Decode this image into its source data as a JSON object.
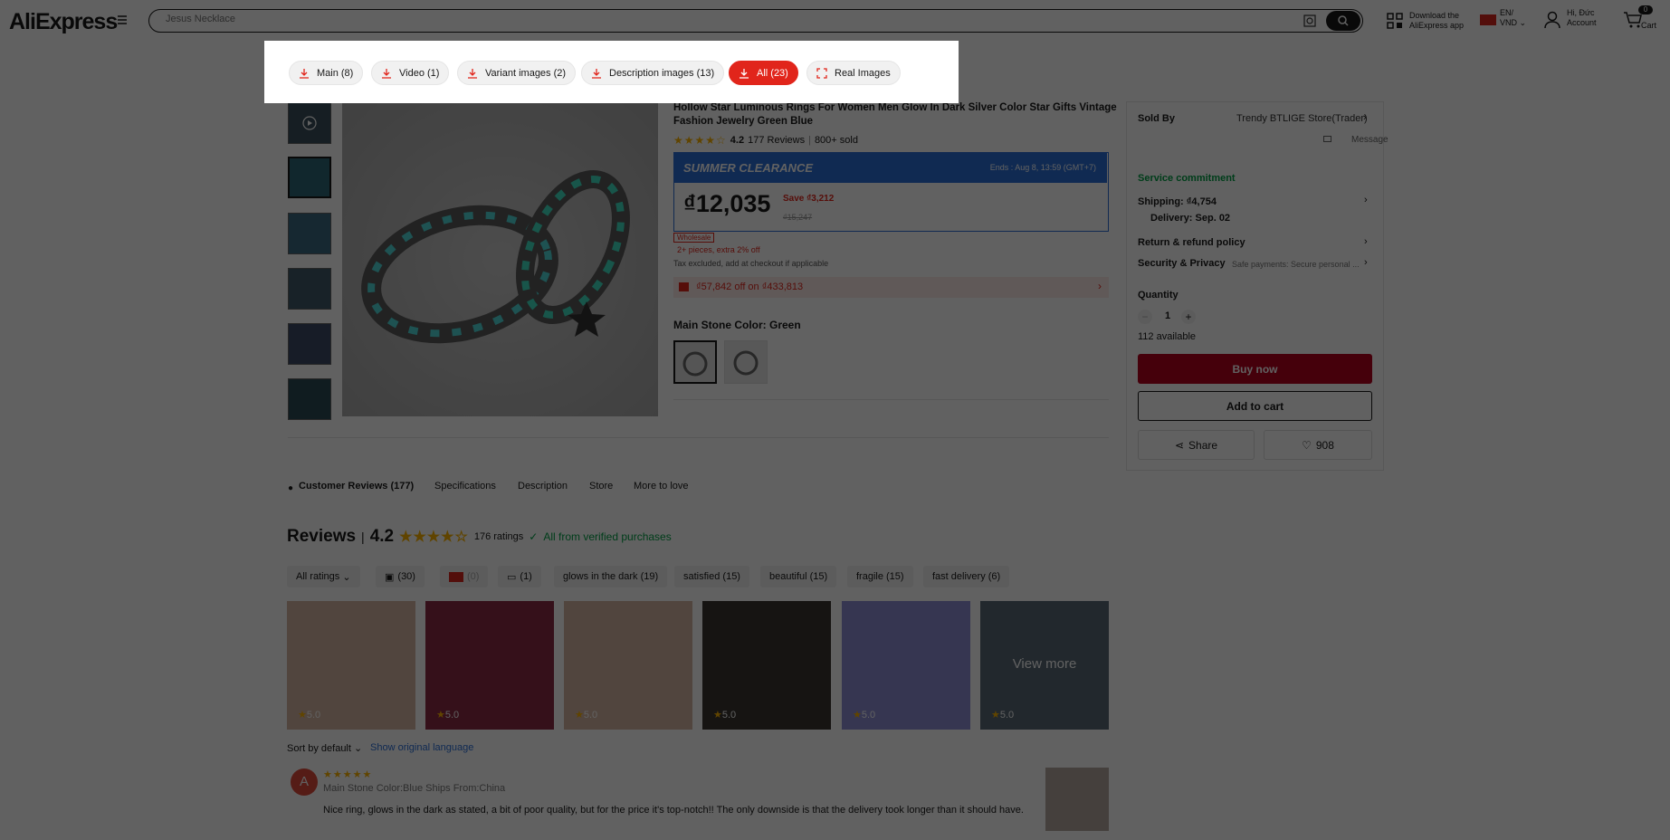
{
  "header": {
    "logo": "AliExpress",
    "search_placeholder": "Jesus Necklace",
    "download_app": [
      "Download the",
      "AliExpress app"
    ],
    "lang": [
      "EN/",
      "VND"
    ],
    "account": [
      "Hi, Đức",
      "Account"
    ],
    "cart_label": "Cart",
    "cart_count": "0"
  },
  "popup": {
    "buttons": [
      {
        "label": "Main (8)"
      },
      {
        "label": "Video (1)"
      },
      {
        "label": "Variant images (2)"
      },
      {
        "label": "Description images (13)"
      },
      {
        "label": "All (23)",
        "active": true
      },
      {
        "label": "Real Images"
      }
    ]
  },
  "product": {
    "title": "Hollow Star Luminous Rings For Women Men Glow In Dark Silver Color Star Gifts Vintage Fashion Jewelry Green Blue",
    "rating": "4.2",
    "reviews": "177 Reviews",
    "sold": "800+ sold",
    "promo": "SUMMER CLEARANCE",
    "ends": "Ends : Aug 8, 13:59 (GMT+7)",
    "price": "₫12,035",
    "save": "Save ₫3,212",
    "original": "₫15,247",
    "wholesale_badge": "Wholesale",
    "wholesale_offer": "2+ pieces, extra 2% off",
    "tax": "Tax excluded, add at checkout if applicable",
    "coupon": "₫57,842 off on ₫433,813",
    "color_label": "Main Stone Color: Green"
  },
  "sidebar": {
    "sold_by": "Sold By",
    "store": "Trendy BTLIGE Store(Trader)",
    "message": "Message",
    "service": "Service commitment",
    "shipping": "Shipping: ₫4,754",
    "delivery": "Delivery: Sep. 02",
    "return": "Return & refund policy",
    "security": "Security & Privacy",
    "security_desc": "Safe payments: Secure personal ...",
    "quantity_label": "Quantity",
    "quantity": "1",
    "available": "112 available",
    "buy_now": "Buy now",
    "add_to_cart": "Add to cart",
    "share": "Share",
    "wishlist": "908"
  },
  "tabs": [
    "Customer Reviews (177)",
    "Specifications",
    "Description",
    "Store",
    "More to love"
  ],
  "reviews": {
    "title": "Reviews",
    "score": "4.2",
    "ratings": "176 ratings",
    "verified": "All from verified purchases",
    "filters": [
      "All ratings",
      "(30)",
      "(0)",
      "(1)",
      "glows in the dark (19)",
      "satisfied (15)",
      "beautiful (15)",
      "fragile (15)",
      "fast delivery (6)"
    ],
    "photo_scores": [
      "5.0",
      "5.0",
      "5.0",
      "5.0",
      "5.0",
      "5.0"
    ],
    "view_more": "View more",
    "sort": "Sort by default",
    "show_original": "Show original language",
    "first": {
      "avatar": "A",
      "meta": "Main Stone Color:Blue Ships From:China",
      "text": "Nice ring, glows in the dark as stated, a bit of poor quality, but for the price it's top-notch!! The only downside is that the delivery took longer than it should have."
    }
  },
  "colors": {
    "accent": "#e1251b",
    "promo_blue": "#2b6fd8",
    "buy": "#b5001f",
    "verified": "#00a046"
  }
}
